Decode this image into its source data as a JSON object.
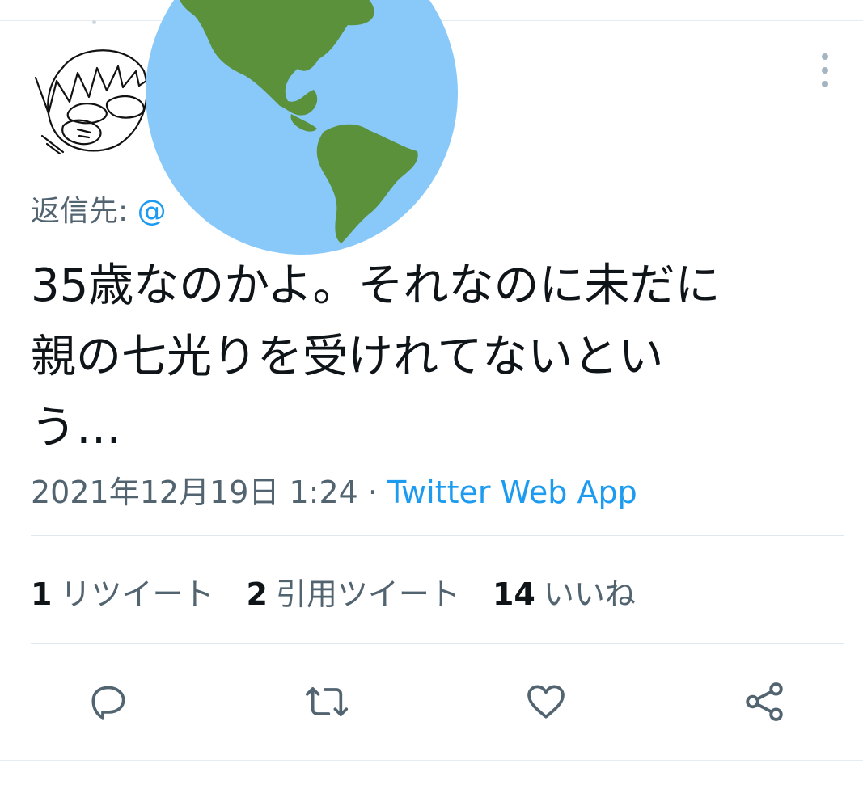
{
  "tweet": {
    "reply_label": "返信先:",
    "reply_handle": "@",
    "text_line1": "35歳なのかよ。それなのに未だに",
    "text_line2": "親の七光りを受けれてないとい",
    "text_line3": "う…",
    "date": "2021年12月19日 1:24",
    "separator": "·",
    "source": "Twitter Web App"
  },
  "stats": {
    "retweets_count": "1",
    "retweets_label": "リツイート",
    "quotes_count": "2",
    "quotes_label": "引用ツイート",
    "likes_count": "14",
    "likes_label": "いいね"
  },
  "icons": {
    "more": "more-vertical-icon",
    "reply": "reply-icon",
    "retweet": "retweet-icon",
    "like": "heart-icon",
    "share": "share-icon"
  },
  "colors": {
    "text": "#0f1419",
    "secondary": "#536471",
    "link": "#1d9bf0",
    "globe_ocean": "#88c9f9",
    "globe_land": "#5c913b"
  }
}
